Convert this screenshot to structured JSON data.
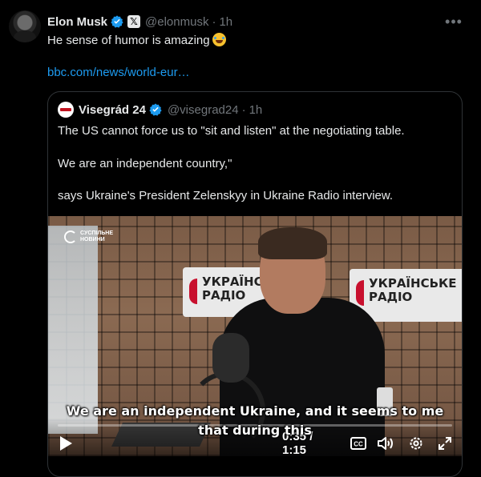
{
  "tweet": {
    "author_name": "Elon Musk",
    "author_handle": "@elonmusk",
    "time": "1h",
    "text": "He sense of humor is amazing",
    "link": "bbc.com/news/world-eur…",
    "more_label": "•••"
  },
  "quote": {
    "author_name": "Visegrád 24",
    "author_handle": "@visegrad24",
    "time": "1h",
    "line1": "The US cannot force us to \"sit and listen\" at the negotiating table.",
    "line2": "We are an independent country,\"",
    "line3": "says Ukraine's President Zelenskyy in Ukraine Radio interview."
  },
  "video": {
    "watermark_line1": "СУСПІЛЬНЕ",
    "watermark_line2": "НОВИНИ",
    "sign_line1": "УКРАЇНСЬКЕ",
    "sign_line2": "РАДІО",
    "subtitle_line1": "We are an independent Ukraine, and it seems to me",
    "subtitle_line2": "that during this",
    "time_display": "0:35 / 1:15",
    "progress": 0.0,
    "cc_label": "CC"
  },
  "colors": {
    "accent": "#1d9bf0",
    "verified": "#1d9bf0",
    "text_primary": "#e7e9ea",
    "text_secondary": "#71767b"
  },
  "icons": [
    "avatar",
    "verified-badge-icon",
    "x-affiliate-icon",
    "more-icon",
    "play-icon",
    "captions-icon",
    "volume-icon",
    "settings-icon",
    "fullscreen-icon"
  ]
}
